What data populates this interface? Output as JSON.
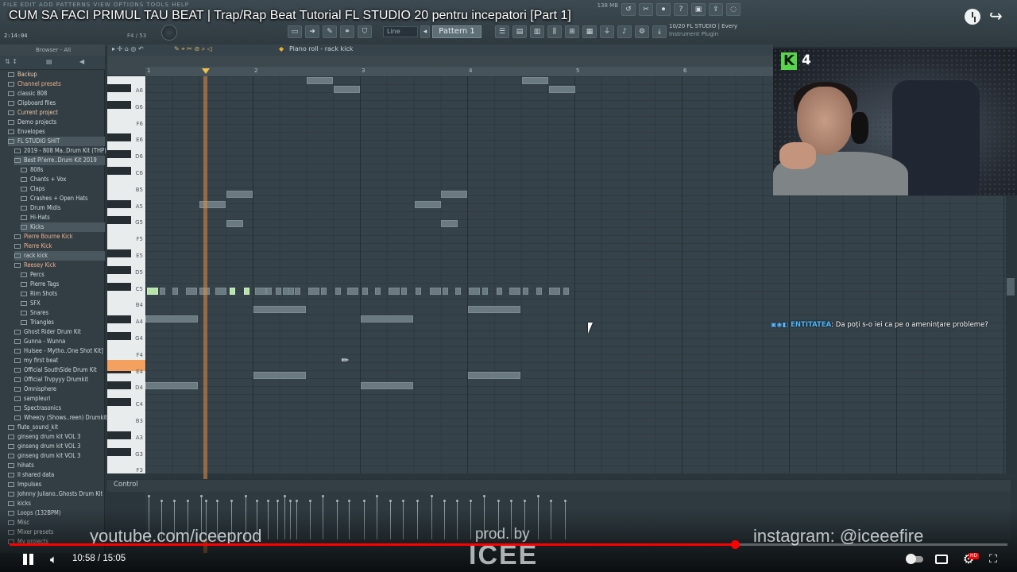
{
  "video": {
    "title": "CUM SA FACI PRIMUL TAU BEAT | Trap/Rap Beat Tutorial FL STUDIO 20 pentru incepatori [Part 1]",
    "current_time": "10:58",
    "duration": "15:05",
    "time_display": "10:58 / 15:05",
    "progress_fraction": 0.727
  },
  "fl_toolbar": {
    "menu_text": "FILE EDIT ADD PATTERNS VIEW OPTIONS TOOLS HELP",
    "song_position": "2:14:04",
    "bar_info": "F4 / 53",
    "cpu_info": "138 MB",
    "line_mode": "Line",
    "pattern": "Pattern 1",
    "hint_title": "10/20  FL STUDIO | Every",
    "hint_sub": "Instrument Plugin"
  },
  "browser": {
    "header": "Browser - All",
    "items": [
      {
        "label": "Backup",
        "indent": 0,
        "style": "hot"
      },
      {
        "label": "Channel presets",
        "indent": 0,
        "style": "hl"
      },
      {
        "label": "classic 808",
        "indent": 0,
        "style": ""
      },
      {
        "label": "Clipboard files",
        "indent": 0,
        "style": ""
      },
      {
        "label": "Current project",
        "indent": 0,
        "style": "hot"
      },
      {
        "label": "Demo projects",
        "indent": 0,
        "style": ""
      },
      {
        "label": "Envelopes",
        "indent": 0,
        "style": ""
      },
      {
        "label": "FL STUDIO SHIT",
        "indent": 0,
        "style": "sel"
      },
      {
        "label": "2019 - 808 Ma..Drum Kit (THP)",
        "indent": 1,
        "style": ""
      },
      {
        "label": "Best Pi'erre..Drum Kit 2019",
        "indent": 1,
        "style": "sel"
      },
      {
        "label": "808s",
        "indent": 2,
        "style": ""
      },
      {
        "label": "Chants + Vox",
        "indent": 2,
        "style": ""
      },
      {
        "label": "Claps",
        "indent": 2,
        "style": ""
      },
      {
        "label": "Crashes + Open Hats",
        "indent": 2,
        "style": ""
      },
      {
        "label": "Drum Midis",
        "indent": 2,
        "style": ""
      },
      {
        "label": "Hi-Hats",
        "indent": 2,
        "style": ""
      },
      {
        "label": "Kicks",
        "indent": 2,
        "style": "sel"
      },
      {
        "label": "Pierre Bourne Kick",
        "indent": 1,
        "style": "hl"
      },
      {
        "label": "Pierre Kick",
        "indent": 1,
        "style": "hl"
      },
      {
        "label": "rack kick",
        "indent": 1,
        "style": "sel"
      },
      {
        "label": "Reesey Kick",
        "indent": 1,
        "style": "hl"
      },
      {
        "label": "Percs",
        "indent": 2,
        "style": ""
      },
      {
        "label": "Pierre Tags",
        "indent": 2,
        "style": ""
      },
      {
        "label": "Rim Shots",
        "indent": 2,
        "style": ""
      },
      {
        "label": "SFX",
        "indent": 2,
        "style": ""
      },
      {
        "label": "Snares",
        "indent": 2,
        "style": ""
      },
      {
        "label": "Triangles",
        "indent": 2,
        "style": ""
      },
      {
        "label": "Ghost Rider Drum Kit",
        "indent": 1,
        "style": ""
      },
      {
        "label": "Gunna - Wunna",
        "indent": 1,
        "style": ""
      },
      {
        "label": "Hulsee - Mytho..One Shot Kit]",
        "indent": 1,
        "style": ""
      },
      {
        "label": "my first beat",
        "indent": 1,
        "style": ""
      },
      {
        "label": "Official SouthSide Drum Kit",
        "indent": 1,
        "style": ""
      },
      {
        "label": "Official Trvpyyy Drumkit",
        "indent": 1,
        "style": ""
      },
      {
        "label": "Omnisphere",
        "indent": 1,
        "style": ""
      },
      {
        "label": "sampleuri",
        "indent": 1,
        "style": ""
      },
      {
        "label": "Spectrasonics",
        "indent": 1,
        "style": ""
      },
      {
        "label": "Wheezy (Shows..reen) Drumkit",
        "indent": 1,
        "style": ""
      },
      {
        "label": "flute_sound_kit",
        "indent": 0,
        "style": ""
      },
      {
        "label": "ginseng drum kit VOL 3",
        "indent": 0,
        "style": ""
      },
      {
        "label": "ginseng drum kit VOL 3",
        "indent": 0,
        "style": ""
      },
      {
        "label": "ginseng drum kit VOL 3",
        "indent": 0,
        "style": ""
      },
      {
        "label": "hihats",
        "indent": 0,
        "style": ""
      },
      {
        "label": "Il shared data",
        "indent": 0,
        "style": ""
      },
      {
        "label": "Impulses",
        "indent": 0,
        "style": ""
      },
      {
        "label": "Johnny Juliano..Ghosts Drum Kit",
        "indent": 0,
        "style": ""
      },
      {
        "label": "kicks",
        "indent": 0,
        "style": ""
      },
      {
        "label": "Loops (132BPM)",
        "indent": 0,
        "style": ""
      },
      {
        "label": "Misc",
        "indent": 0,
        "style": ""
      },
      {
        "label": "Mixer presets",
        "indent": 0,
        "style": ""
      },
      {
        "label": "My projects",
        "indent": 0,
        "style": ""
      }
    ]
  },
  "piano_roll": {
    "title": "Piano roll - rack kick",
    "bars": [
      "1",
      "2",
      "3",
      "4",
      "5",
      "6"
    ],
    "key_labels": [
      "A6",
      "G6",
      "F6",
      "E6",
      "D6",
      "C6",
      "B5",
      "A5",
      "G5",
      "F5",
      "E5",
      "D5",
      "C5",
      "B4",
      "A4",
      "G4",
      "F4",
      "E4",
      "D4",
      "C4",
      "B3",
      "A3",
      "G3",
      "F3"
    ],
    "control_label": "Control"
  },
  "webcam": {
    "viewer_count": "4",
    "platform_logo": "K"
  },
  "chat": {
    "user": "ENTITATEA",
    "message": ": Da poți s-o iei ca pe o amenințare probleme?"
  },
  "watermark": {
    "left": "youtube.com/iceeprod",
    "center_top": "prod. by",
    "center": "ICEE",
    "right": "instagram: @iceeefire"
  },
  "colors": {
    "youtube_red": "#ff0000",
    "playhead": "#f2c14a",
    "c5_key": "#f4a05f",
    "kick_green": "#59d44d"
  }
}
